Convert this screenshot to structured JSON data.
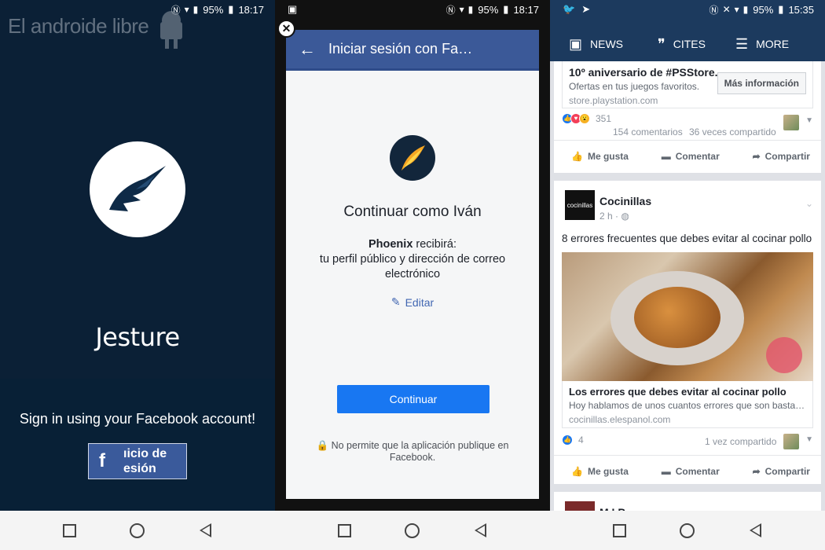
{
  "phone1": {
    "status": {
      "battery": "95%",
      "time": "18:17"
    },
    "watermark": "El androide libre",
    "app_name": "Jesture",
    "signin_text": "Sign in using your Facebook account!",
    "fb_button_label": "ıicio de\nesión"
  },
  "phone2": {
    "status": {
      "battery": "95%",
      "time": "18:17"
    },
    "header_title": "Iniciar sesión con Fac…",
    "continue_as": "Continuar como Iván",
    "app_name": "Phoenix",
    "receives": " recibirá:",
    "permissions": "tu perfil público y dirección de correo electrónico",
    "edit_label": "Editar",
    "continue_button": "Continuar",
    "no_post_notice": "No permite que la aplicación publique en Facebook."
  },
  "phone3": {
    "status": {
      "battery": "95%",
      "time": "15:35"
    },
    "tabs": {
      "news": "NEWS",
      "cites": "CITES",
      "more": "MORE"
    },
    "post1": {
      "ad_title": "10º aniversario de #PSStore.",
      "ad_desc": "Ofertas en tus juegos favoritos.",
      "ad_url": "store.playstation.com",
      "cta": "Más información",
      "reactions_count": "351",
      "comments": "154 comentarios",
      "shares": "36 veces compartido"
    },
    "post2": {
      "page_name": "Cocinillas",
      "page_logo_text": "cocinillas",
      "time": "2 h ·",
      "text": "8 errores frecuentes que debes evitar al cocinar pollo",
      "link_title": "Los errores que debes evitar al cocinar pollo",
      "link_desc": "Hoy hablamos de unos cuantos errores que son basta…",
      "link_url": "cocinillas.elespanol.com",
      "reactions_count": "4",
      "shares": "1 vez compartido"
    },
    "post3": {
      "page_name_partial": "M   I P"
    },
    "actions": {
      "like": "Me gusta",
      "comment": "Comentar",
      "share": "Compartir"
    }
  },
  "colors": {
    "fb_blue": "#3b5998",
    "fb_button": "#1877f2",
    "app_dark": "#0b2036",
    "news_bar": "#1c3a5e"
  }
}
